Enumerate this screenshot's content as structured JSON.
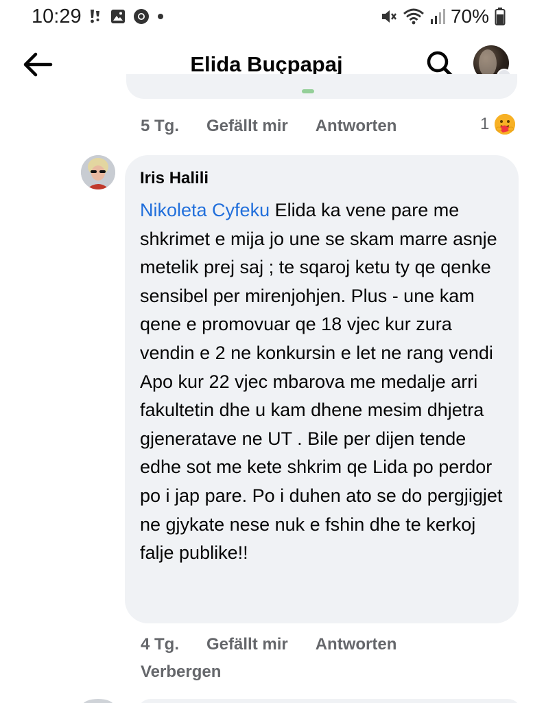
{
  "status_bar": {
    "time": "10:29",
    "battery": "70%",
    "left_icons": [
      "notification-alert-icon",
      "gallery-icon",
      "chrome-icon",
      "dot-icon"
    ],
    "right_icons": [
      "mute-icon",
      "wifi-icon",
      "signal-icon",
      "battery-icon"
    ]
  },
  "header": {
    "title": "Elida Buçpapaj"
  },
  "previous_comment": {
    "time": "5 Tg.",
    "like_label": "Gefällt mir",
    "reply_label": "Antworten",
    "reaction_count": "1",
    "reaction_icon": "care-emoji-icon"
  },
  "comment": {
    "author": "Iris Halili",
    "mention": "Nikoleta Cyfeku",
    "text": " Elida ka vene pare me shkrimet e mija jo une se skam marre asnje metelik prej saj ; te sqaroj  ketu ty qe qenke sensibel per mirenjohjen. Plus - une kam qene e promovuar qe 18 vjec kur zura vendin e 2 ne konkursin e let ne rang vendi Apo kur 22 vjec mbarova  me medalje arri fakultetin dhe u kam dhene mesim  dhjetra gjeneratave ne UT . Bile per dijen  tende edhe sot me kete shkrim qe Lida po perdor po i jap pare. Po i duhen ato se do pergjigjet ne gjykate nese nuk e fshin dhe te kerkoj falje publike!!",
    "time": "4 Tg.",
    "like_label": "Gefällt mir",
    "reply_label": "Antworten",
    "hide_label": "Verbergen"
  },
  "colors": {
    "bubble": "#f0f2f5",
    "mention": "#216fdb",
    "meta": "#65676b"
  }
}
